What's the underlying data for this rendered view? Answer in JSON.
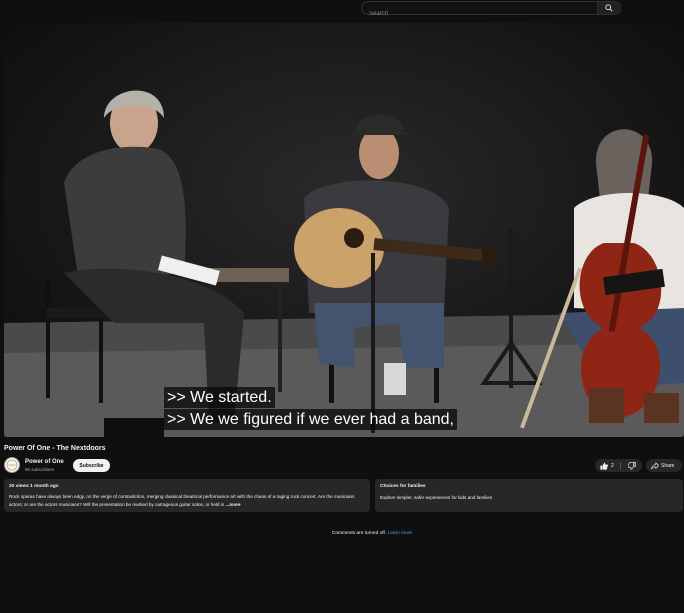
{
  "search": {
    "placeholder": "Search"
  },
  "video": {
    "captions": [
      ">> We started.",
      ">> We we figured if we ever had a band,"
    ]
  },
  "title": "Power Of One - The Nextdoors",
  "channel": {
    "name": "Power of One",
    "subscribers": "90 subscribers",
    "subscribe_label": "Subscribe"
  },
  "actions": {
    "like_count": "2",
    "share_label": "Share"
  },
  "description": {
    "meta": "20 views  1 month ago",
    "text": "Rock operas have always been edgy, on the verge of contradiction, merging classical theatrical performance art with the chaos of a raging rock concert.  Are the musicians actors; or are the actors musicians?  Will the presentation be marked by outrageous guitar solos, or held in ",
    "more_label": "...more"
  },
  "promo": {
    "title": "Choices for families",
    "text": "Explore simpler, safer experiences for kids and families"
  },
  "comments": {
    "text": "Comments are turned off.",
    "link": "Learn more"
  }
}
